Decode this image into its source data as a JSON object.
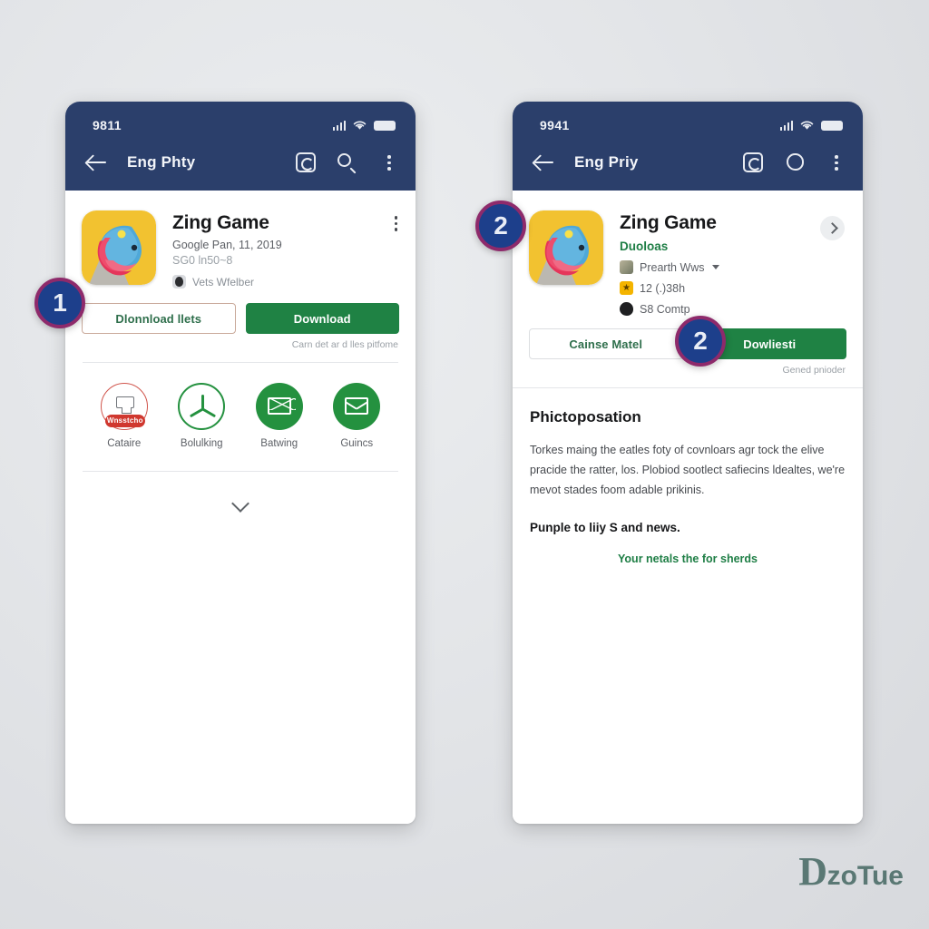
{
  "watermark": {
    "part1": "D",
    "part2": "zoTue"
  },
  "markers": {
    "one": "1",
    "two_left": "2",
    "two_right": "2"
  },
  "left_phone": {
    "status": {
      "time": "9811",
      "signal_icon": "signal-bars-icon",
      "wifi_icon": "wifi-icon",
      "battery_icon": "battery-icon"
    },
    "appbar": {
      "back_icon": "back-arrow-icon",
      "title": "Eng Phty",
      "camera_icon": "camera-icon",
      "search_icon": "search-icon",
      "menu_icon": "kebab-menu-icon"
    },
    "app": {
      "icon_name": "zing-game-app-icon",
      "title": "Zing Game",
      "subtitle": "Google Pan, 11, 2019",
      "size": "SG0 ln50~8",
      "verified_icon": "verified-badge-icon",
      "verified_text": "Vets Wfelber",
      "kebab_icon": "kebab-menu-icon"
    },
    "buttons": {
      "secondary": "Dlonnload llets",
      "primary": "Download",
      "note": "Carn det ar d lles pitfome"
    },
    "actions": [
      {
        "label": "Cataire",
        "icon_name": "printer-icon",
        "pill": "Wnsstcho"
      },
      {
        "label": "Bolulking",
        "icon_name": "fan-icon",
        "pill": ""
      },
      {
        "label": "Batwing",
        "icon_name": "envelope-icon",
        "pill": ""
      },
      {
        "label": "Guincs",
        "icon_name": "envelope-cross-icon",
        "pill": ""
      }
    ],
    "expand_icon": "chevron-down-icon"
  },
  "right_phone": {
    "status": {
      "time": "9941",
      "signal_icon": "signal-bars-icon",
      "wifi_icon": "wifi-icon",
      "battery_icon": "battery-icon"
    },
    "appbar": {
      "back_icon": "back-arrow-icon",
      "title": "Eng Priy",
      "camera_icon": "camera-icon",
      "ring_icon": "circle-ring-icon",
      "menu_icon": "kebab-menu-icon"
    },
    "app": {
      "icon_name": "zing-game-app-icon",
      "title": "Zing Game",
      "developer": "Duoloas",
      "meta_category": "Prearth Wws",
      "meta_rating": "12 (.)38h",
      "meta_downloads": "S8 Comtp",
      "chevron_icon": "chevron-right-icon"
    },
    "buttons": {
      "secondary": "Cainse Matel",
      "primary": "Dowliesti",
      "note": "Gened pnioder"
    },
    "description": {
      "heading": "Phictoposation",
      "paragraph": "Torkes maing the eatles foty of covnloars agr tock the elive pracide the ratter, los. Plobiod sootlect safiecins ldealtes, we're mevot stades foom adable prikinis.",
      "bold_line": "Punple to liiy S and news.",
      "link": "Your netals the for sherds"
    }
  }
}
